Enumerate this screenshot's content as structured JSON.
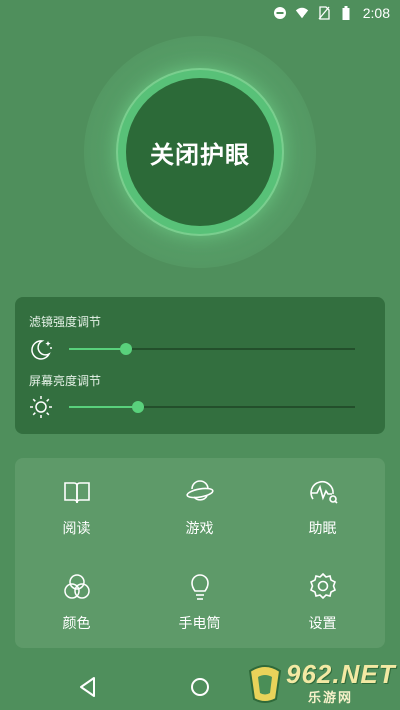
{
  "status_bar": {
    "time": "2:08",
    "icons": [
      "do-not-disturb-icon",
      "wifi-icon",
      "no-sim-icon",
      "battery-icon"
    ]
  },
  "toggle": {
    "label": "关闭护眼"
  },
  "filter_panel": {
    "strength_label": "滤镜强度调节",
    "strength_icon": "moon-stars-icon",
    "strength_value": 0.2,
    "brightness_label": "屏幕亮度调节",
    "brightness_icon": "sun-icon",
    "brightness_value": 0.24
  },
  "functions": [
    {
      "label": "阅读",
      "icon": "book-icon"
    },
    {
      "label": "游戏",
      "icon": "planet-icon"
    },
    {
      "label": "助眠",
      "icon": "sleep-pulse-icon"
    },
    {
      "label": "颜色",
      "icon": "color-circles-icon"
    },
    {
      "label": "手电筒",
      "icon": "bulb-icon"
    },
    {
      "label": "设置",
      "icon": "gear-icon"
    }
  ],
  "nav_bar": {
    "icons": [
      "back-icon",
      "home-icon"
    ]
  },
  "watermark": {
    "brand": "962.NET",
    "sub": "乐游网"
  },
  "colors": {
    "background": "#4f8f5c",
    "toggle_core": "#2c6a38",
    "toggle_ring": "#58c178",
    "panel": "#336f3f",
    "slider_accent": "#59d17c",
    "grid_card": "#5e9a69"
  }
}
